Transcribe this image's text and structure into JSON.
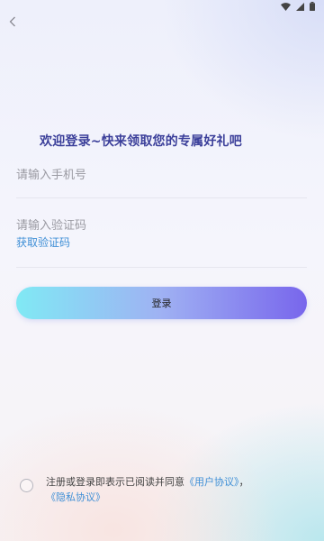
{
  "status_bar": {
    "icons": [
      "wifi-icon",
      "signal-icon",
      "battery-icon"
    ]
  },
  "nav": {
    "back_icon": "chevron-left-icon"
  },
  "headline": "欢迎登录~快来领取您的专属好礼吧",
  "form": {
    "phone_placeholder": "请输入手机号",
    "code_placeholder": "请输入验证码",
    "get_code_label": "获取验证码",
    "login_label": "登录"
  },
  "agreement": {
    "prefix": "注册或登录即表示已阅读并同意",
    "user_agreement": "《用户协议》",
    "separator": "，",
    "privacy_policy": "《隐私协议》",
    "checked": false
  },
  "colors": {
    "headline": "#3b3f9a",
    "link": "#3f8fd6",
    "button_start": "#80e9f4",
    "button_end": "#7866ec"
  }
}
